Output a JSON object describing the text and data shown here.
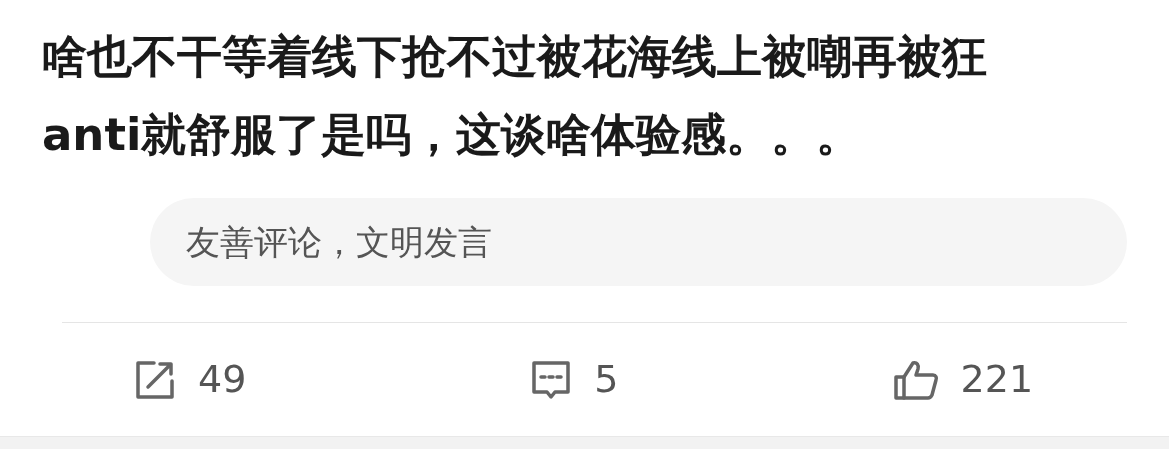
{
  "post": {
    "text": "啥也不干等着线下抢不过被花海线上被嘲再被狂anti就舒服了是吗，这谈啥体验感。。。"
  },
  "comment_box": {
    "placeholder": "友善评论，文明发言"
  },
  "actions": [
    {
      "kind": "share",
      "count": "49"
    },
    {
      "kind": "comment",
      "count": "5"
    },
    {
      "kind": "like",
      "count": "221"
    }
  ]
}
